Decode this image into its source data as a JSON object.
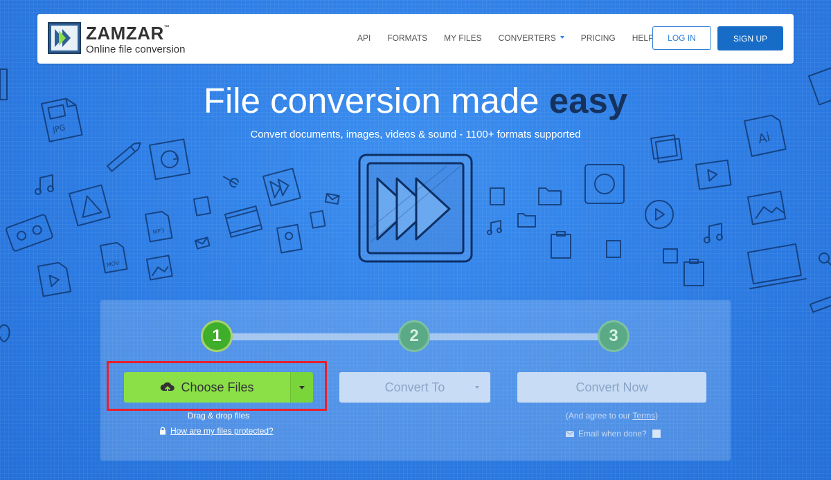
{
  "logo": {
    "name": "ZAMZAR",
    "tm": "™",
    "tagline": "Online file conversion"
  },
  "nav": {
    "items": [
      {
        "label": "API"
      },
      {
        "label": "FORMATS"
      },
      {
        "label": "MY FILES"
      },
      {
        "label": "CONVERTERS"
      },
      {
        "label": "PRICING"
      },
      {
        "label": "HELP"
      }
    ],
    "login": "LOG IN",
    "signup": "SIGN UP"
  },
  "hero": {
    "title_main": "File conversion made ",
    "title_emphasis": "easy",
    "subtitle": "Convert documents, images, videos & sound - 1100+ formats supported"
  },
  "steps": [
    "1",
    "2",
    "3"
  ],
  "choose": {
    "label": "Choose Files",
    "drag_text": "Drag & drop files",
    "protected_link": "How are my files protected?"
  },
  "convert_to": {
    "label": "Convert To"
  },
  "convert_now": {
    "label": "Convert Now",
    "agree_prefix": "(And agree to our ",
    "terms": "Terms",
    "agree_suffix": ")",
    "email_label": "Email when done?"
  },
  "colors": {
    "background": "#2f7fe6",
    "choose_green": "#8be048",
    "step_active": "#3fae2a",
    "signup_blue": "#176cc8",
    "highlight_red": "#e8202a",
    "title_emphasis": "#15325f"
  }
}
